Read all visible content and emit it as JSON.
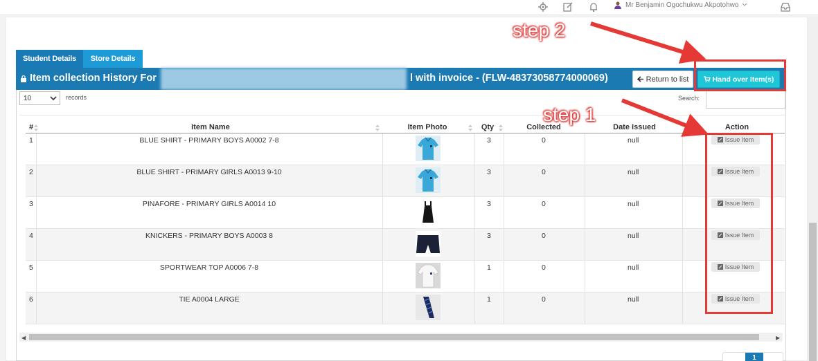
{
  "topbar": {
    "user_name": "Mr Benjamin Ogochukwu Akpotohwo",
    "icons": [
      "gear-icon",
      "edit-icon",
      "bell-icon",
      "chevron-down-icon",
      "inbox-icon"
    ]
  },
  "tabs": [
    {
      "label": "Student Details"
    },
    {
      "label": "Store Details"
    }
  ],
  "header": {
    "title_prefix": "Item collection History For",
    "title_suffix": "l with invoice - (FLW-48373058774000069)",
    "return_label": "Return to list",
    "handover_label": "Hand over Item(s)"
  },
  "controls": {
    "page_length": "10",
    "records_label": "records",
    "search_label": "Search:"
  },
  "table": {
    "columns": [
      "#",
      "Item Name",
      "Item Photo",
      "Qty",
      "Collected",
      "Date Issued",
      "Action"
    ],
    "rows": [
      {
        "num": "1",
        "name": "BLUE SHIRT - PRIMARY BOYS A0002 7-8",
        "photo": "blue-shirt",
        "qty": "3",
        "collected": "0",
        "date": "null",
        "action": "Issue Item"
      },
      {
        "num": "2",
        "name": "BLUE SHIRT - PRIMARY GIRLS A0013 9-10",
        "photo": "blue-shirt",
        "qty": "3",
        "collected": "0",
        "date": "null",
        "action": "Issue Item"
      },
      {
        "num": "3",
        "name": "PINAFORE - PRIMARY GIRLS A0014 10",
        "photo": "pinafore",
        "qty": "3",
        "collected": "0",
        "date": "null",
        "action": "Issue Item"
      },
      {
        "num": "4",
        "name": "KNICKERS - PRIMARY BOYS A0003 8",
        "photo": "knickers",
        "qty": "3",
        "collected": "0",
        "date": "null",
        "action": "Issue Item"
      },
      {
        "num": "5",
        "name": "SPORTWEAR TOP A0006 7-8",
        "photo": "white-top",
        "qty": "1",
        "collected": "0",
        "date": "null",
        "action": "Issue Item"
      },
      {
        "num": "6",
        "name": "TIE A0004 LARGE",
        "photo": "tie",
        "qty": "1",
        "collected": "0",
        "date": "null",
        "action": "Issue Item"
      }
    ]
  },
  "pagination": {
    "current": "1"
  },
  "annotations": {
    "step1": "step 1",
    "step2": "step 2",
    "color": "#e53935"
  },
  "colors": {
    "header_blue": "#1c7ab2",
    "tab_active": "#1e9bd7",
    "handover_cyan": "#1fc6d8"
  }
}
